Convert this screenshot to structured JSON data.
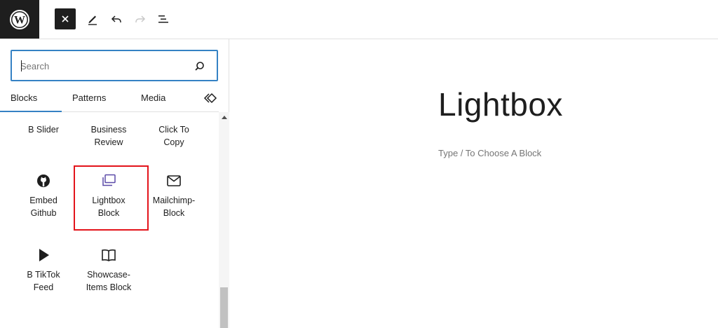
{
  "toolbar": {
    "logo_icon": "wordpress-logo-icon",
    "close_icon": "close-icon",
    "tools_icon": "pencil-icon",
    "undo_icon": "undo-icon",
    "redo_icon": "redo-icon",
    "list_view_icon": "list-view-icon"
  },
  "inserter": {
    "search": {
      "placeholder": "Search",
      "value": "",
      "icon": "search-icon"
    },
    "tabs": [
      {
        "label": "Blocks",
        "selected": true
      },
      {
        "label": "Patterns",
        "selected": false
      },
      {
        "label": "Media",
        "selected": false
      }
    ],
    "collapse_icon": "collapse-icon",
    "blocks": [
      {
        "label_line1": "B Slider",
        "label_line2": ""
      },
      {
        "label_line1": "Business",
        "label_line2": "Review"
      },
      {
        "label_line1": "Click To",
        "label_line2": "Copy"
      },
      {
        "label_line1": "Embed",
        "label_line2": "Github",
        "icon": "github-icon"
      },
      {
        "label_line1": "Lightbox",
        "label_line2": "Block",
        "icon": "lightbox-icon",
        "highlighted": true,
        "highlight_color": "#e3141b",
        "icon_color": "#5b4aa8"
      },
      {
        "label_line1": "Mailchimp-",
        "label_line2": "Block",
        "icon": "envelope-icon"
      },
      {
        "label_line1": "B TikTok",
        "label_line2": "Feed",
        "icon": "play-icon"
      },
      {
        "label_line1": "Showcase-",
        "label_line2": "Items Block",
        "icon": "book-icon"
      }
    ]
  },
  "editor": {
    "title": "Lightbox",
    "block_prompt": "Type / To Choose A Block"
  },
  "colors": {
    "accent": "#3582c4",
    "toolbar_dark": "#1e1e1e",
    "highlight": "#e3141b"
  }
}
